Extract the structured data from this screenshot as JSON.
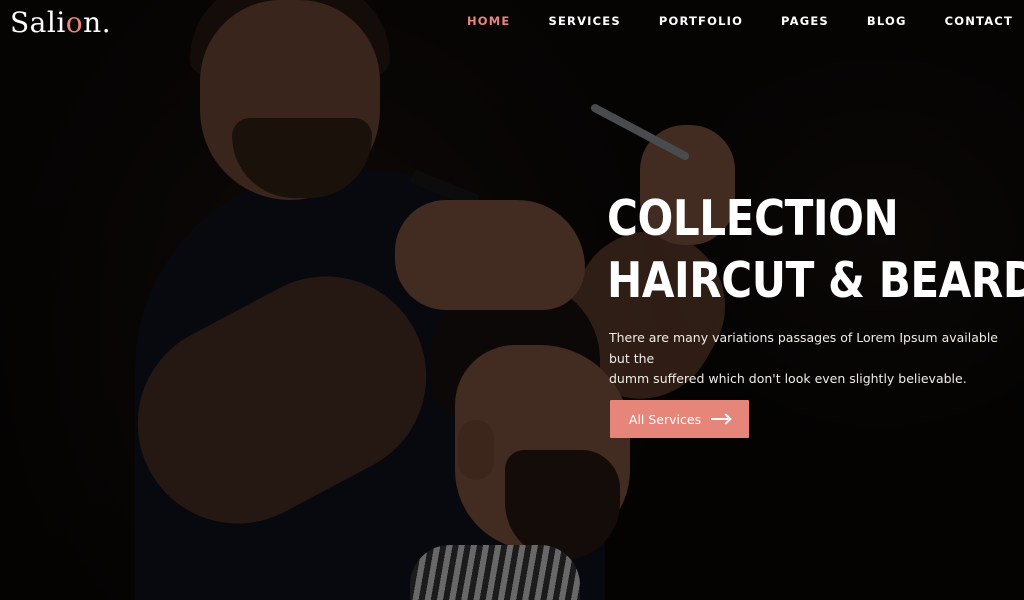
{
  "brand": {
    "name_start": "Sali",
    "name_accent": "o",
    "name_end": "n.",
    "accent_color": "#e6857a"
  },
  "nav": {
    "items": [
      {
        "label": "HOME",
        "active": true
      },
      {
        "label": "SERVICES"
      },
      {
        "label": "PORTFOLIO"
      },
      {
        "label": "PAGES"
      },
      {
        "label": "BLOG"
      },
      {
        "label": "CONTACT"
      }
    ]
  },
  "hero": {
    "headline_line1": "COLLECTION",
    "headline_line2": "HAIRCUT & BEARD",
    "subtext_line1": "There are many variations passages of Lorem Ipsum available but the",
    "subtext_line2": "dumm suffered which don't look even slightly believable.",
    "cta_label": "All Services",
    "cta_icon": "arrow-right-icon",
    "background_image": "barber-cutting-client-hair"
  }
}
